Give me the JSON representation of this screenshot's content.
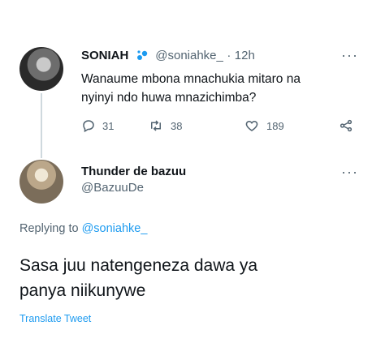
{
  "tweet": {
    "author_name": "SONIAH",
    "author_handle": "@soniahke_",
    "separator": "·",
    "time": "12h",
    "text_line1": "Wanaume mbona mnachukia mitaro na",
    "text_line2": "nyinyi ndo huwa mnazichimba?",
    "replies": "31",
    "retweets": "38",
    "likes": "189",
    "more_label": "···"
  },
  "reply": {
    "author_name": "Thunder de bazuu",
    "author_handle": "@BazuuDe",
    "more_label": "···",
    "replying_prefix": "Replying to",
    "replying_handle": "@soniahke_",
    "text_line1": "Sasa juu natengeneza dawa ya",
    "text_line2": "panya niikunywe",
    "translate_label": "Translate Tweet"
  },
  "icons": {
    "verified": "verified-badge-icon",
    "reply": "reply-icon",
    "retweet": "retweet-icon",
    "like": "heart-icon",
    "share": "share-icon"
  },
  "colors": {
    "accent": "#1d9bf0",
    "secondary_text": "#536471",
    "primary_text": "#0f1419"
  }
}
